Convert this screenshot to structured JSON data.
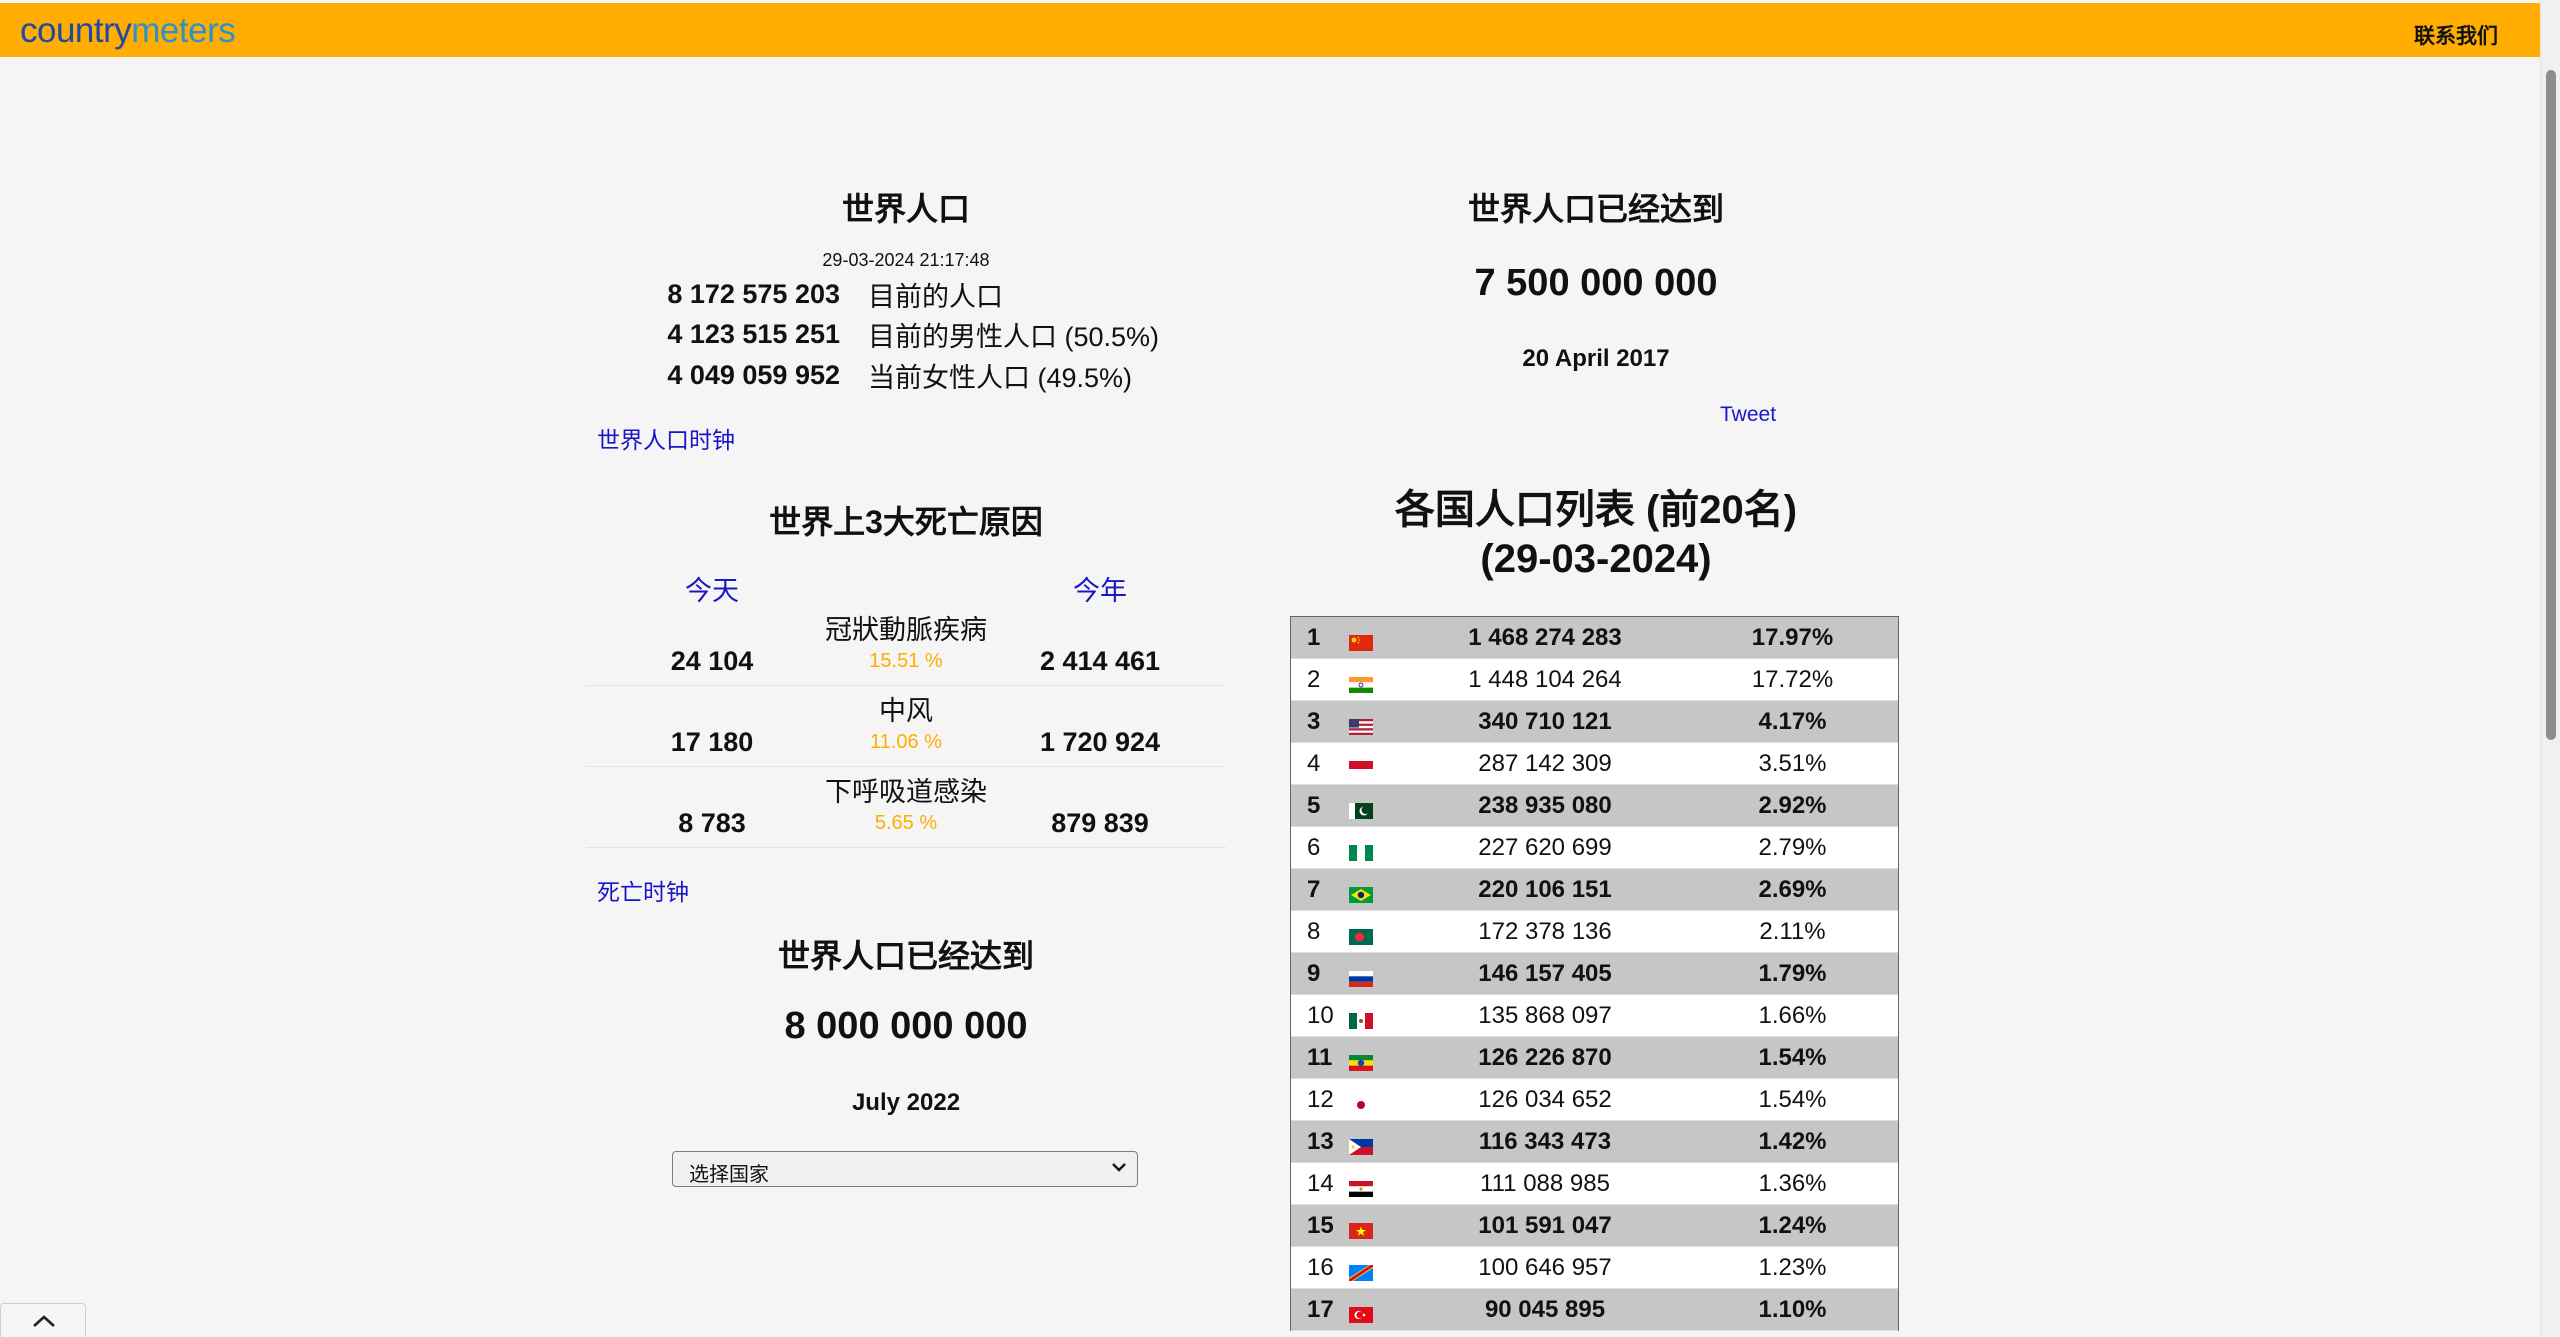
{
  "header": {
    "logo_part1": "country",
    "logo_part2": "meters",
    "contact_label": "联系我们"
  },
  "world_population": {
    "title": "世界人口",
    "timestamp": "29-03-2024 21:17:48",
    "rows": [
      {
        "value": "8 172 575 203",
        "label": "目前的人口"
      },
      {
        "value": "4 123 515 251",
        "label": "目前的男性人口 (50.5%)"
      },
      {
        "value": "4 049 059 952",
        "label": "当前女性人口 (49.5%)"
      }
    ],
    "clock_link": "世界人口时钟"
  },
  "death_causes": {
    "title": "世界上3大死亡原因",
    "col_today": "今天",
    "col_year": "今年",
    "items": [
      {
        "name": "冠狀動脈疾病",
        "today": "24 104",
        "percent": "15.51 %",
        "year": "2 414 461"
      },
      {
        "name": "中风",
        "today": "17 180",
        "percent": "11.06 %",
        "year": "1 720 924"
      },
      {
        "name": "下呼吸道感染",
        "today": "8 783",
        "percent": "5.65 %",
        "year": "879 839"
      }
    ],
    "clock_link": "死亡时钟"
  },
  "milestone_left": {
    "title": "世界人口已经达到",
    "value": "8 000 000 000",
    "date": "July 2022"
  },
  "country_select": {
    "selected": "选择国家"
  },
  "milestone_right": {
    "title": "世界人口已经达到",
    "value": "7 500 000 000",
    "date": "20 April 2017",
    "tweet": "Tweet"
  },
  "country_list": {
    "title_line1": "各国人口列表 (前20名)",
    "title_line2": "(29-03-2024)",
    "rows": [
      {
        "rank": "1",
        "flag": "china-flag",
        "population": "1 468 274 283",
        "share": "17.97%"
      },
      {
        "rank": "2",
        "flag": "india-flag",
        "population": "1 448 104 264",
        "share": "17.72%"
      },
      {
        "rank": "3",
        "flag": "usa-flag",
        "population": "340 710 121",
        "share": "4.17%"
      },
      {
        "rank": "4",
        "flag": "indonesia-flag",
        "population": "287 142 309",
        "share": "3.51%"
      },
      {
        "rank": "5",
        "flag": "pakistan-flag",
        "population": "238 935 080",
        "share": "2.92%"
      },
      {
        "rank": "6",
        "flag": "nigeria-flag",
        "population": "227 620 699",
        "share": "2.79%"
      },
      {
        "rank": "7",
        "flag": "brazil-flag",
        "population": "220 106 151",
        "share": "2.69%"
      },
      {
        "rank": "8",
        "flag": "bangladesh-flag",
        "population": "172 378 136",
        "share": "2.11%"
      },
      {
        "rank": "9",
        "flag": "russia-flag",
        "population": "146 157 405",
        "share": "1.79%"
      },
      {
        "rank": "10",
        "flag": "mexico-flag",
        "population": "135 868 097",
        "share": "1.66%"
      },
      {
        "rank": "11",
        "flag": "ethiopia-flag",
        "population": "126 226 870",
        "share": "1.54%"
      },
      {
        "rank": "12",
        "flag": "japan-flag",
        "population": "126 034 652",
        "share": "1.54%"
      },
      {
        "rank": "13",
        "flag": "philippines-flag",
        "population": "116 343 473",
        "share": "1.42%"
      },
      {
        "rank": "14",
        "flag": "egypt-flag",
        "population": "111 088 985",
        "share": "1.36%"
      },
      {
        "rank": "15",
        "flag": "vietnam-flag",
        "population": "101 591 047",
        "share": "1.24%"
      },
      {
        "rank": "16",
        "flag": "drcongo-flag",
        "population": "100 646 957",
        "share": "1.23%"
      },
      {
        "rank": "17",
        "flag": "turkey-flag",
        "population": "90 045 895",
        "share": "1.10%"
      }
    ]
  }
}
